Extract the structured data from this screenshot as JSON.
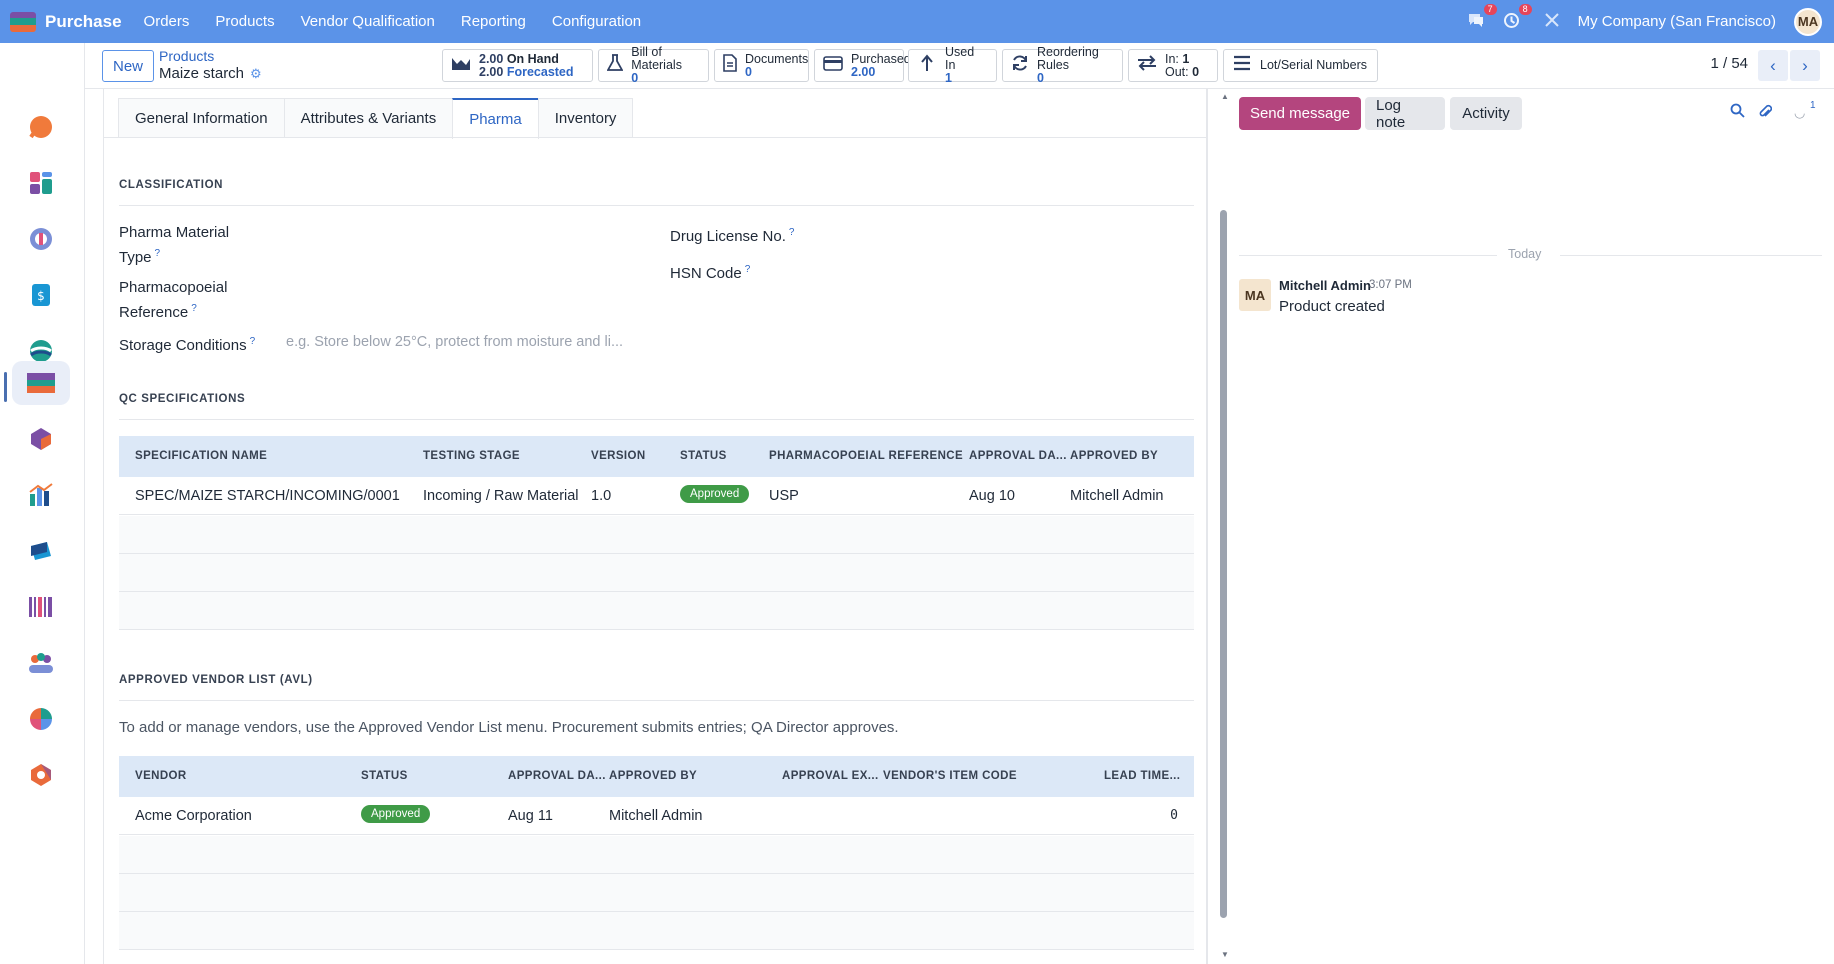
{
  "navbar": {
    "app_name": "Purchase",
    "menus": [
      "Orders",
      "Products",
      "Vendor Qualification",
      "Reporting",
      "Configuration"
    ],
    "messages_badge": "7",
    "activities_badge": "8",
    "company": "My Company (San Francisco)",
    "user_initials": "MA"
  },
  "breadcrumb": {
    "new_button": "New",
    "parent": "Products",
    "current": "Maize starch"
  },
  "smart_buttons": {
    "on_hand_value": "2.00",
    "on_hand_label": "On Hand",
    "forecast_value": "2.00",
    "forecast_label": "Forecasted",
    "bom_label": "Bill of Materials",
    "bom_value": "0",
    "documents_label": "Documents",
    "documents_value": "0",
    "purchased_label": "Purchased",
    "purchased_value": "2.00",
    "used_in_label": "Used In",
    "used_in_value": "1",
    "reordering_label": "Reordering Rules",
    "reordering_value": "0",
    "in_label": "In:",
    "in_value": "1",
    "out_label": "Out:",
    "out_value": "0",
    "lots_label": "Lot/Serial Numbers"
  },
  "pager": {
    "text": "1 / 54"
  },
  "tabs": [
    "General Information",
    "Attributes & Variants",
    "Pharma",
    "Inventory"
  ],
  "classification": {
    "title": "CLASSIFICATION",
    "pharma_type_label_1": "Pharma Material",
    "pharma_type_label_2": "Type",
    "pharmacopoeial_label_1": "Pharmacopoeial",
    "pharmacopoeial_label_2": "Reference",
    "storage_label": "Storage Conditions",
    "storage_placeholder": "e.g. Store below 25°C, protect from moisture and li...",
    "drug_license_label": "Drug License No.",
    "hsn_label": "HSN Code",
    "help_mark": "?"
  },
  "qc": {
    "title": "QC SPECIFICATIONS",
    "headers": [
      "SPECIFICATION NAME",
      "TESTING STAGE",
      "VERSION",
      "STATUS",
      "PHARMACOPOEIAL REFERENCE",
      "APPROVAL DA...",
      "APPROVED BY"
    ],
    "row": {
      "name": "SPEC/MAIZE STARCH/INCOMING/0001",
      "stage": "Incoming / Raw Material",
      "version": "1.0",
      "status": "Approved",
      "reference": "USP",
      "date": "Aug 10",
      "approved_by": "Mitchell Admin"
    }
  },
  "avl": {
    "title": "APPROVED VENDOR LIST (AVL)",
    "help": "To add or manage vendors, use the Approved Vendor List menu. Procurement submits entries; QA Director approves.",
    "headers": [
      "VENDOR",
      "STATUS",
      "APPROVAL DA...",
      "APPROVED BY",
      "APPROVAL EX...",
      "VENDOR'S ITEM CODE",
      "LEAD TIME..."
    ],
    "row": {
      "vendor": "Acme Corporation",
      "status": "Approved",
      "date": "Aug 11",
      "approved_by": "Mitchell Admin",
      "expiry": "",
      "item_code": "",
      "lead_time": "0"
    }
  },
  "chatter": {
    "send_message": "Send message",
    "log_note": "Log note",
    "activity": "Activity",
    "followers_count": "1",
    "date_separator": "Today",
    "message": {
      "author": "Mitchell Admin",
      "time": "3:07 PM",
      "body": "Product created",
      "avatar_initials": "MA"
    }
  },
  "colors": {
    "navbar": "#5b93e8",
    "primary": "#2e66c4",
    "send_button": "#b4457e",
    "approved_badge": "#3f9b47",
    "grid_header": "#dce8f7"
  }
}
